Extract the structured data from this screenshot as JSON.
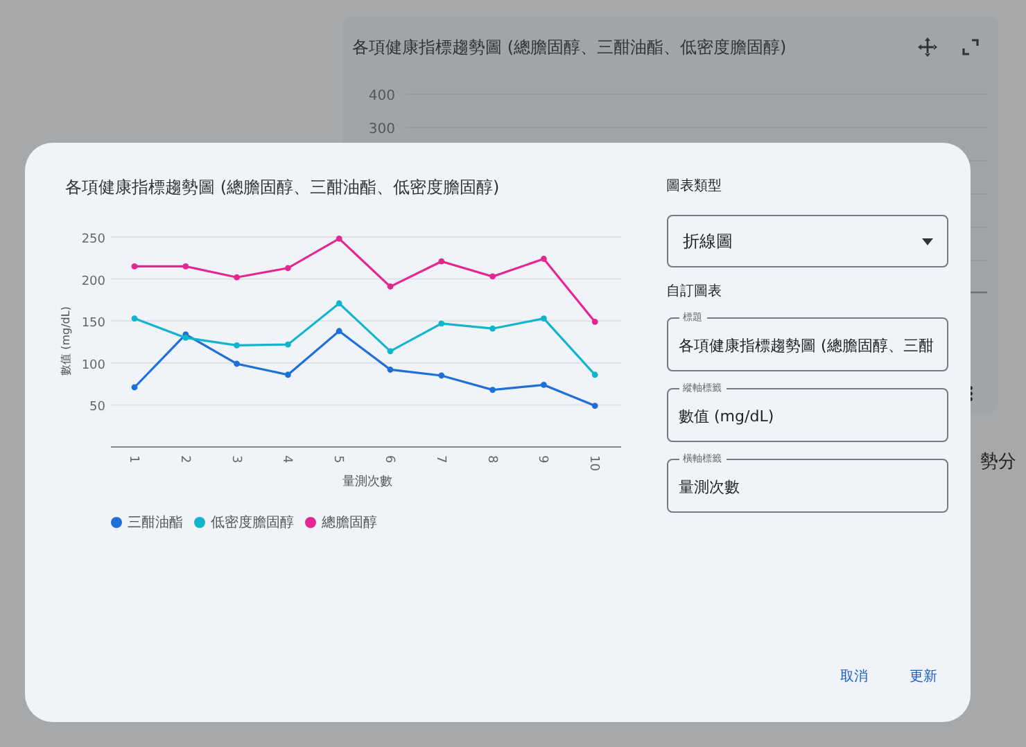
{
  "background": {
    "card": {
      "title": "各項健康指標趨勢圖 (總膽固醇、三酣油酯、低密度膽固醇)",
      "yticks": [
        "400",
        "300"
      ]
    },
    "side_text": "勢分"
  },
  "dialog": {
    "chart_data": {
      "type": "line",
      "title": "各項健康指標趨勢圖 (總膽固醇、三酣油酯、低密度膽固醇)",
      "xlabel": "量測次數",
      "ylabel": "數值 (mg/dL)",
      "categories": [
        "1",
        "2",
        "3",
        "4",
        "5",
        "6",
        "7",
        "8",
        "9",
        "10"
      ],
      "ylim": [
        0,
        250
      ],
      "grid": true,
      "yticks": [
        50,
        100,
        150,
        200,
        250
      ],
      "series": [
        {
          "name": "三酣油酯",
          "color": "#1f6fd8",
          "marker": "circle",
          "values": [
            71,
            134,
            99,
            86,
            138,
            92,
            85,
            68,
            74,
            49
          ]
        },
        {
          "name": "低密度膽固醇",
          "color": "#12b5cb",
          "marker": "circle",
          "values": [
            153,
            130,
            121,
            122,
            171,
            114,
            147,
            141,
            153,
            86
          ]
        },
        {
          "name": "總膽固醇",
          "color": "#e52592",
          "marker": "circle",
          "values": [
            215,
            215,
            202,
            213,
            248,
            191,
            221,
            203,
            224,
            149
          ]
        }
      ]
    },
    "panel": {
      "type_label": "圖表類型",
      "chart_type": "折線圖",
      "customize_label": "自訂圖表",
      "fields": [
        {
          "label": "標題",
          "value": "各項健康指標趨勢圖 (總膽固醇、三酣"
        },
        {
          "label": "縱軸標籤",
          "value": "數值 (mg/dL)"
        },
        {
          "label": "橫軸標籤",
          "value": "量測次數"
        }
      ]
    },
    "buttons": [
      "取消",
      "更新"
    ]
  }
}
